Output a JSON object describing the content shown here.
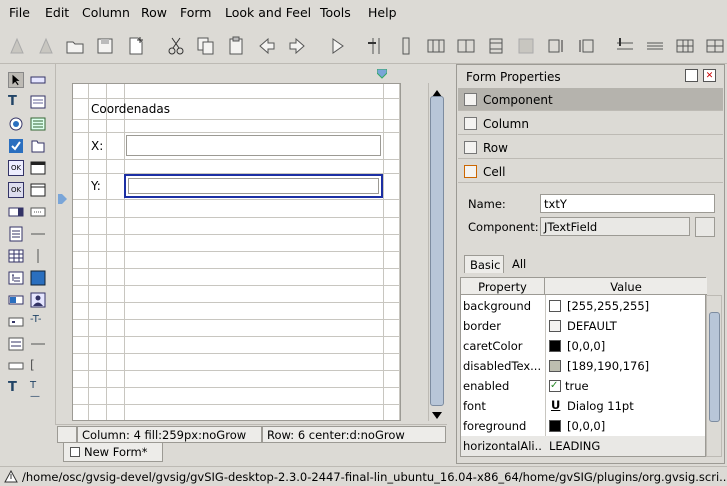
{
  "menubar": {
    "items": [
      "File",
      "Edit",
      "Column",
      "Row",
      "Form",
      "Look and Feel",
      "Tools",
      "Help"
    ]
  },
  "form": {
    "title": "Coordenadas",
    "label_x": "X:",
    "label_y": "Y:",
    "value_x": "",
    "value_y": ""
  },
  "status": {
    "column": "Column:  4   fill:259px:noGrow",
    "row": "Row:  6   center:d:noGrow"
  },
  "tab": {
    "label": "New Form*"
  },
  "panel": {
    "title": "Form Properties",
    "sections": [
      "Component",
      "Column",
      "Row",
      "Cell"
    ],
    "name_label": "Name:",
    "name_value": "txtY",
    "component_label": "Component:",
    "component_value": "JTextField",
    "tabs": [
      "Basic",
      "All"
    ],
    "table_headers": [
      "Property",
      "Value"
    ],
    "properties": [
      {
        "name": "background",
        "value": "[255,255,255]",
        "swatch": "#ffffff",
        "kind": "color"
      },
      {
        "name": "border",
        "value": "DEFAULT",
        "swatch": "#f4f3f1",
        "kind": "border"
      },
      {
        "name": "caretColor",
        "value": "[0,0,0]",
        "swatch": "#000000",
        "kind": "color"
      },
      {
        "name": "disabledTex...",
        "value": "[189,190,176]",
        "swatch": "#bdbeb0",
        "kind": "color"
      },
      {
        "name": "enabled",
        "value": "true",
        "swatch": "",
        "kind": "check"
      },
      {
        "name": "font",
        "value": "Dialog 11pt",
        "swatch": "",
        "kind": "font"
      },
      {
        "name": "foreground",
        "value": "[0,0,0]",
        "swatch": "#000000",
        "kind": "color"
      },
      {
        "name": "horizontalAli...",
        "value": "LEADING",
        "swatch": "",
        "kind": "combo"
      }
    ]
  },
  "footer": {
    "path": "/home/osc/gvsig-devel/gvsig/gvSIG-desktop-2.3.0-2447-final-lin_ubuntu_16.04-x86_64/home/gvSIG/plugins/org.gvsig.scri..."
  },
  "colors": {
    "accent": "#1c2fa3",
    "window": "#dcdad5"
  }
}
